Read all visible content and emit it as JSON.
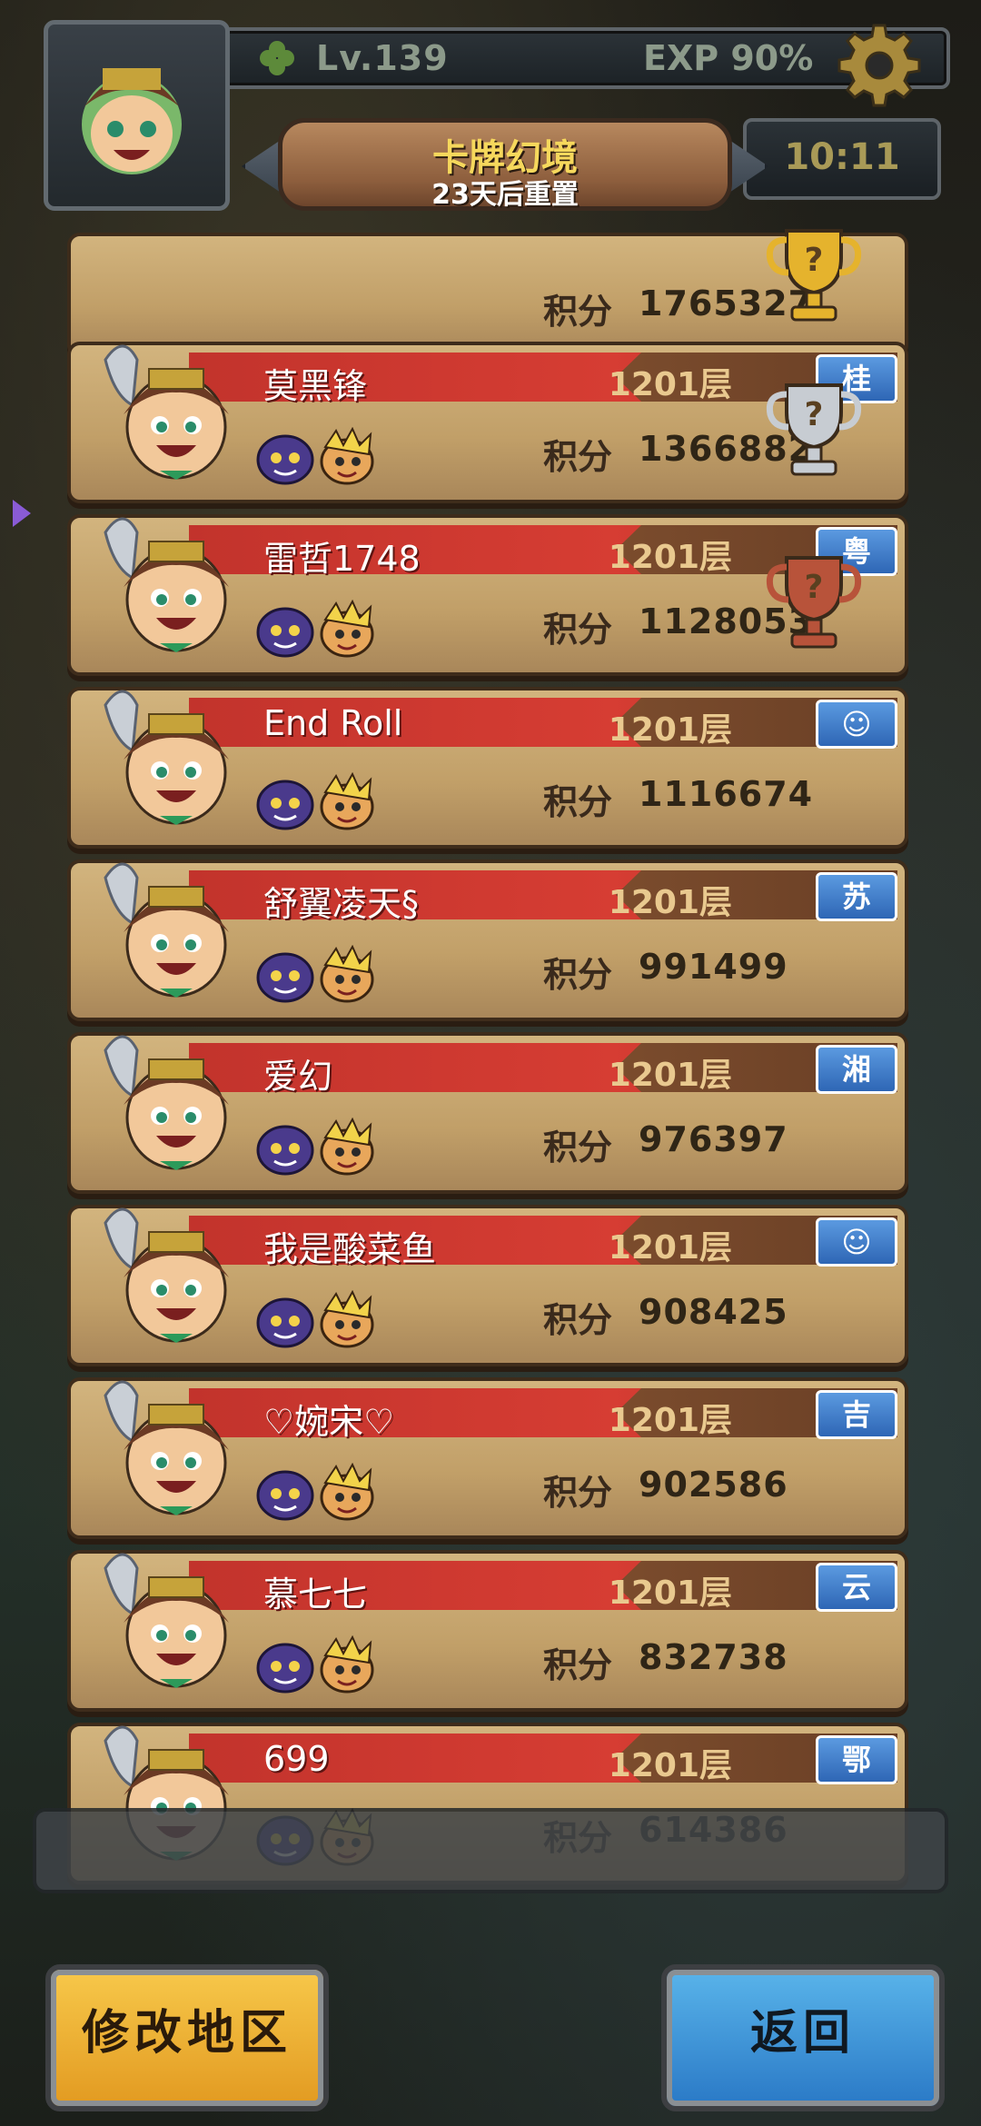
{
  "header": {
    "level": "Lv.139",
    "exp": "EXP 90%",
    "title": "卡牌幻境",
    "subtitle": "23天后重置",
    "time": "10:11"
  },
  "score_label": "积分",
  "rows": [
    {
      "name": "",
      "floor": "",
      "region": "",
      "score": "1765327",
      "trophy": "gold"
    },
    {
      "name": "莫黑锋",
      "floor": "1201层",
      "region": "桂",
      "score": "1366882",
      "trophy": "silver"
    },
    {
      "name": "雷哲1748",
      "floor": "1201层",
      "region": "粤",
      "score": "1128053",
      "trophy": "bronze"
    },
    {
      "name": "End Roll",
      "floor": "1201层",
      "region": "☺",
      "score": "1116674",
      "trophy": ""
    },
    {
      "name": "舒翼凌天§",
      "floor": "1201层",
      "region": "苏",
      "score": "991499",
      "trophy": ""
    },
    {
      "name": "爱幻",
      "floor": "1201层",
      "region": "湘",
      "score": "976397",
      "trophy": ""
    },
    {
      "name": "我是酸菜鱼",
      "floor": "1201层",
      "region": "☺",
      "score": "908425",
      "trophy": ""
    },
    {
      "name": "♡婉宋♡",
      "floor": "1201层",
      "region": "吉",
      "score": "902586",
      "trophy": ""
    },
    {
      "name": "慕七七",
      "floor": "1201层",
      "region": "云",
      "score": "832738",
      "trophy": ""
    },
    {
      "name": "699",
      "floor": "1201层",
      "region": "鄂",
      "score": "614386",
      "trophy": ""
    }
  ],
  "buttons": {
    "change_region": "修改地区",
    "back": "返回"
  },
  "colors": {
    "name_strip": "#d63d33",
    "region_badge": "#2e66b5",
    "card": "#c19f68"
  }
}
